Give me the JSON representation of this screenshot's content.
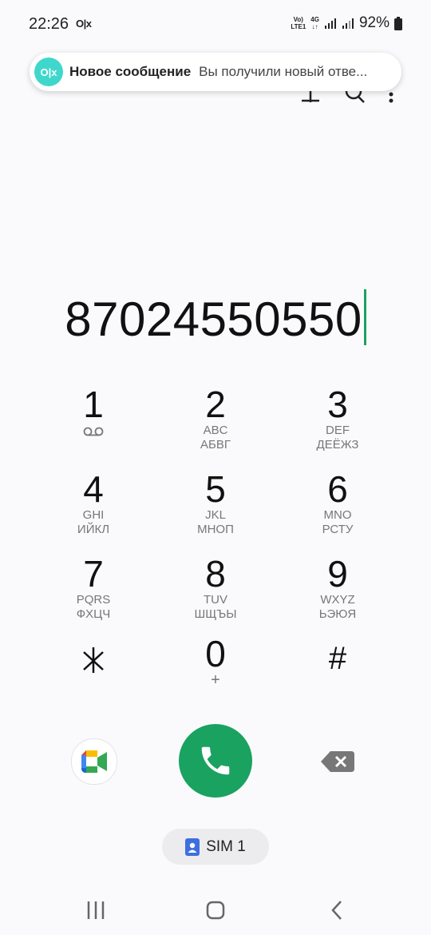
{
  "status_bar": {
    "time": "22:26",
    "app_icon_text": "O|x",
    "volte_line1": "Vo)",
    "volte_line2": "LTE1",
    "network": "4G",
    "battery": "92%"
  },
  "notification": {
    "icon_text": "O|x",
    "title": "Новое сообщение",
    "text": "Вы получили новый отве..."
  },
  "dialer": {
    "number": "87024550550"
  },
  "keypad": [
    {
      "digit": "1",
      "sub": "",
      "sub2": ""
    },
    {
      "digit": "2",
      "sub": "ABC",
      "sub2": "АБВГ"
    },
    {
      "digit": "3",
      "sub": "DEF",
      "sub2": "ДЕЁЖЗ"
    },
    {
      "digit": "4",
      "sub": "GHI",
      "sub2": "ИЙКЛ"
    },
    {
      "digit": "5",
      "sub": "JKL",
      "sub2": "МНОП"
    },
    {
      "digit": "6",
      "sub": "MNO",
      "sub2": "РСТУ"
    },
    {
      "digit": "7",
      "sub": "PQRS",
      "sub2": "ФХЦЧ"
    },
    {
      "digit": "8",
      "sub": "TUV",
      "sub2": "ШЩЪЫ"
    },
    {
      "digit": "9",
      "sub": "WXYZ",
      "sub2": "ЬЭЮЯ"
    },
    {
      "digit": "⁎",
      "sub": "",
      "sub2": ""
    },
    {
      "digit": "0",
      "sub": "+",
      "sub2": ""
    },
    {
      "digit": "#",
      "sub": "",
      "sub2": ""
    }
  ],
  "sim": {
    "label": "SIM 1"
  },
  "icons": {
    "voicemail": "voicemail-icon",
    "add": "plus-icon",
    "search": "search-icon",
    "more": "more-vert-icon",
    "meet": "google-meet-icon",
    "call": "phone-icon",
    "backspace": "backspace-icon",
    "sim": "sim-card-icon",
    "recents": "recent-apps-icon",
    "home": "home-icon",
    "back": "back-icon"
  },
  "colors": {
    "accent_green": "#1aa260",
    "olx_teal": "#3fd7cc",
    "sim_blue": "#3d6fe0"
  }
}
